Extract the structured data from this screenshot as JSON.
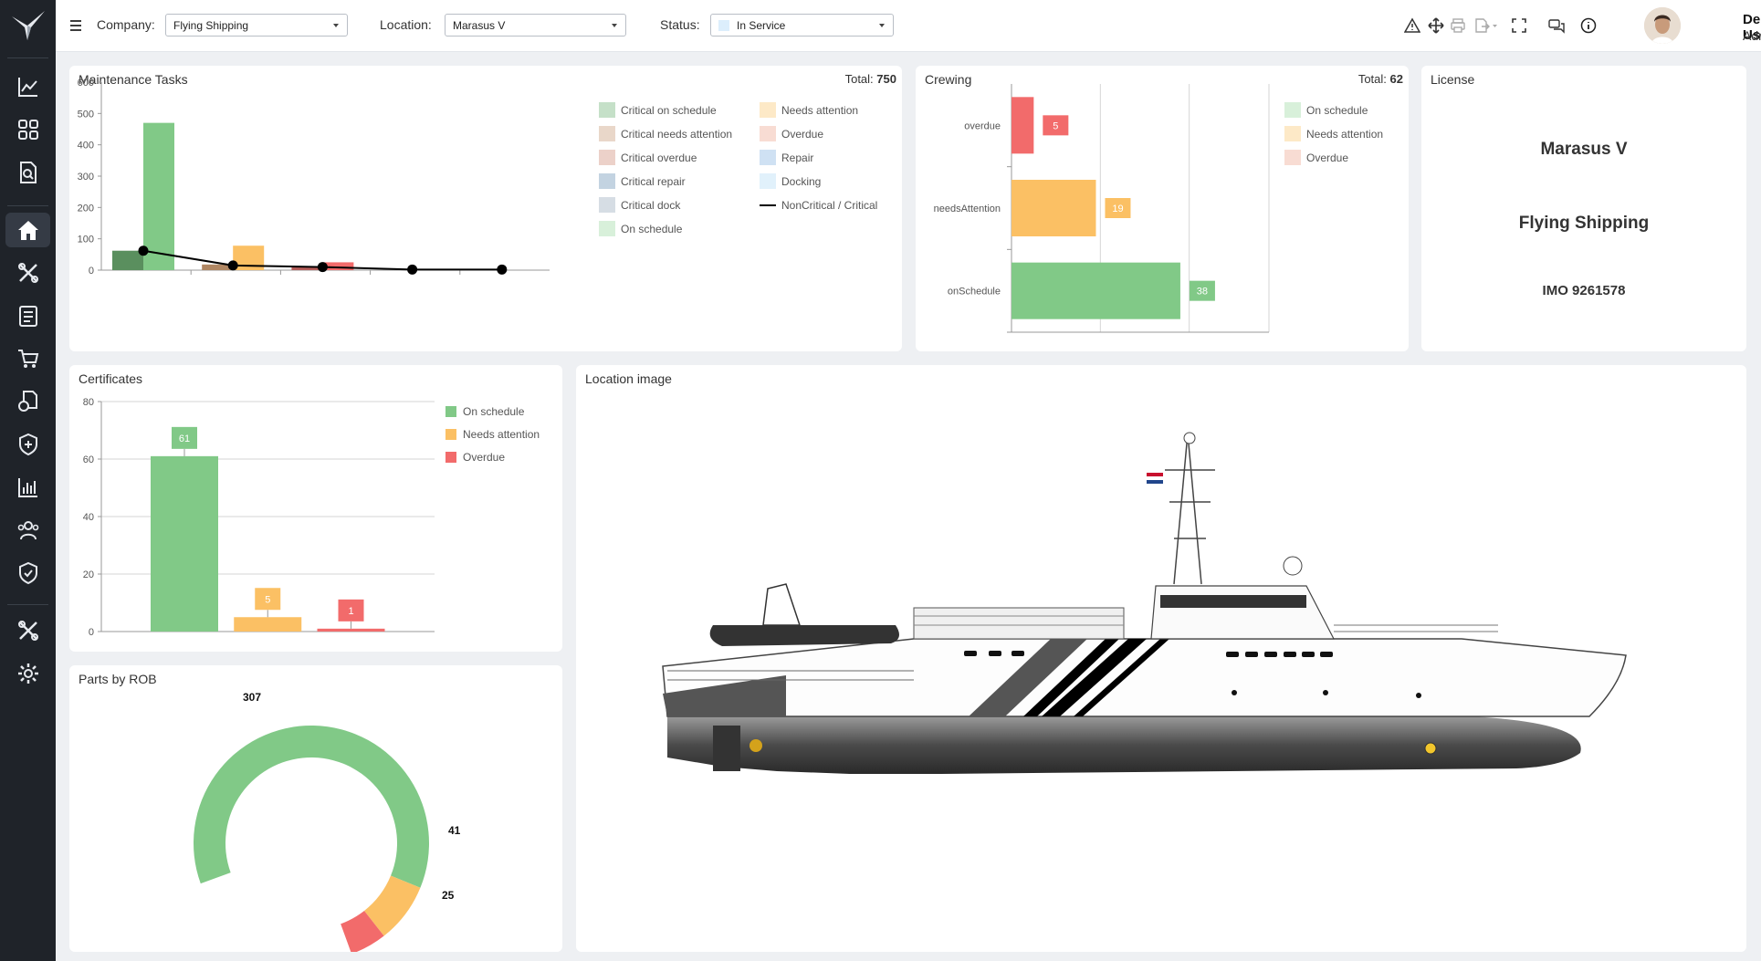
{
  "topbar": {
    "company_label": "Company:",
    "company_value": "Flying Shipping",
    "location_label": "Location:",
    "location_value": "Marasus V",
    "status_label": "Status:",
    "status_value": "In Service",
    "user_name": "Demo User",
    "user_role": "Admin"
  },
  "sidebar": {
    "items": [
      "chart-line-icon",
      "grid-icon",
      "document-search-icon",
      "home-icon",
      "tools-icon",
      "checklist-icon",
      "cart-icon",
      "documents-icon",
      "shield-plus-icon",
      "bar-chart-icon",
      "users-icon",
      "shield-check-icon",
      "tools-icon",
      "gear-icon"
    ]
  },
  "maintenance": {
    "title": "Maintenance Tasks",
    "total_label": "Total:",
    "total_value": "750",
    "legend": [
      {
        "label": "Critical on schedule",
        "color": "#c5e0c8"
      },
      {
        "label": "Needs attention",
        "color": "#fde9c7"
      },
      {
        "label": "Critical needs attention",
        "color": "#e9d7c9"
      },
      {
        "label": "Overdue",
        "color": "#f8dcd3"
      },
      {
        "label": "Critical overdue",
        "color": "#ecd1c9"
      },
      {
        "label": "Repair",
        "color": "#cfe1f3"
      },
      {
        "label": "Critical repair",
        "color": "#c3d3e1"
      },
      {
        "label": "Docking",
        "color": "#e1f1fb"
      },
      {
        "label": "Critical dock",
        "color": "#d6dde4"
      },
      {
        "label": "NonCritical / Critical",
        "color": "#000000"
      },
      {
        "label": "On schedule",
        "color": "#d8f0da"
      }
    ]
  },
  "chart_data": [
    {
      "type": "bar",
      "title": "Maintenance Tasks",
      "ylim": [
        0,
        600
      ],
      "yticks": [
        "0",
        "100",
        "200",
        "300",
        "400",
        "500",
        "600"
      ],
      "series": [
        {
          "name": "Critical on schedule",
          "values": [
            62,
            0,
            0,
            0,
            0
          ],
          "color": "#5a8f5e"
        },
        {
          "name": "On schedule",
          "values": [
            470,
            0,
            0,
            0,
            0
          ],
          "color": "#81c987"
        },
        {
          "name": "Critical needs attention",
          "values": [
            0,
            18,
            0,
            0,
            0
          ],
          "color": "#b08763"
        },
        {
          "name": "Needs attention",
          "values": [
            0,
            78,
            0,
            0,
            0
          ],
          "color": "#fbc064"
        },
        {
          "name": "Critical overdue",
          "values": [
            0,
            0,
            12,
            0,
            0
          ],
          "color": "#b65d5a"
        },
        {
          "name": "Overdue",
          "values": [
            0,
            0,
            25,
            0,
            0
          ],
          "color": "#f26b6b"
        }
      ],
      "line": {
        "name": "NonCritical / Critical",
        "values": [
          62,
          15,
          10,
          2,
          2
        ]
      }
    },
    {
      "type": "bar",
      "title": "Crewing",
      "orientation": "horizontal",
      "categories": [
        "overdue",
        "needsAttention",
        "onSchedule"
      ],
      "values": [
        5,
        19,
        38
      ],
      "colors": [
        "#f26b6b",
        "#fbc064",
        "#81c987"
      ],
      "xlim": [
        0,
        60
      ]
    },
    {
      "type": "bar",
      "title": "Certificates",
      "categories": [
        "On schedule",
        "Needs attention",
        "Overdue"
      ],
      "values": [
        61,
        5,
        1
      ],
      "colors": [
        "#81c987",
        "#fbc064",
        "#f26b6b"
      ],
      "ylim": [
        0,
        80
      ],
      "yticks": [
        "0",
        "20",
        "40",
        "60",
        "80"
      ]
    },
    {
      "type": "pie",
      "title": "Parts by ROB",
      "values": [
        307,
        41,
        25
      ],
      "colors": [
        "#81c987",
        "#fbc064",
        "#f26b6b"
      ]
    }
  ],
  "crewing": {
    "title": "Crewing",
    "total_label": "Total:",
    "total_value": "62",
    "legend": [
      {
        "label": "On schedule",
        "color": "#d8f0da"
      },
      {
        "label": "Needs attention",
        "color": "#fde9c7"
      },
      {
        "label": "Overdue",
        "color": "#f8dcd3"
      }
    ]
  },
  "license": {
    "title": "License",
    "vessel": "Marasus V",
    "company": "Flying Shipping",
    "imo": "IMO 9261578"
  },
  "certificates": {
    "title": "Certificates",
    "legend": [
      {
        "label": "On schedule",
        "color": "#81c987"
      },
      {
        "label": "Needs attention",
        "color": "#fbc064"
      },
      {
        "label": "Overdue",
        "color": "#f26b6b"
      }
    ]
  },
  "parts": {
    "title": "Parts by ROB"
  },
  "location_image": {
    "title": "Location image"
  }
}
